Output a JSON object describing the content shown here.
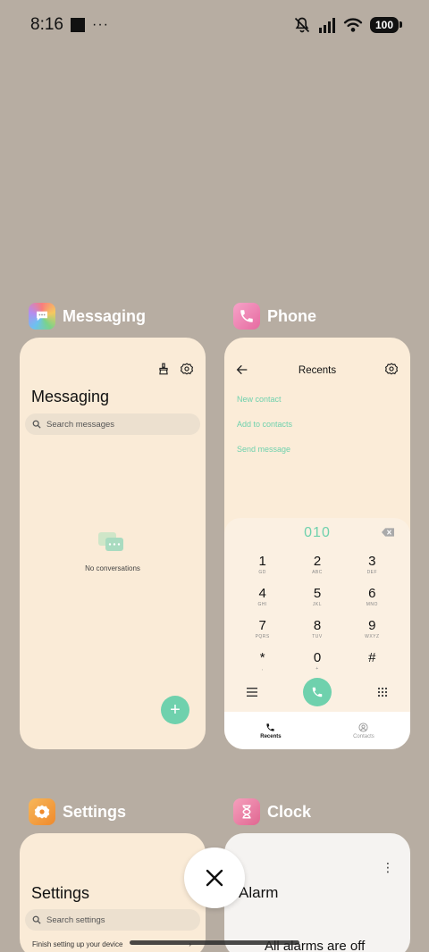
{
  "status_bar": {
    "time": "8:16",
    "dots": "···",
    "battery": "100"
  },
  "colors": {
    "accent": "#6fd1ad",
    "background": "#b7ada2",
    "card": "#faebd7"
  },
  "apps": {
    "messaging": {
      "label": "Messaging",
      "icon": "messaging-icon",
      "title": "Messaging",
      "search_placeholder": "Search messages",
      "empty_text": "No conversations"
    },
    "phone": {
      "label": "Phone",
      "icon": "phone-icon",
      "title": "Recents",
      "links": [
        "New contact",
        "Add to contacts",
        "Send message"
      ],
      "dial_number": "010",
      "keys": [
        {
          "digit": "1",
          "letters": "GD"
        },
        {
          "digit": "2",
          "letters": "ABC"
        },
        {
          "digit": "3",
          "letters": "DEF"
        },
        {
          "digit": "4",
          "letters": "GHI"
        },
        {
          "digit": "5",
          "letters": "JKL"
        },
        {
          "digit": "6",
          "letters": "MNO"
        },
        {
          "digit": "7",
          "letters": "PQRS"
        },
        {
          "digit": "8",
          "letters": "TUV"
        },
        {
          "digit": "9",
          "letters": "WXYZ"
        },
        {
          "digit": "*",
          "letters": ","
        },
        {
          "digit": "0",
          "letters": "+"
        },
        {
          "digit": "#",
          "letters": ""
        }
      ],
      "tabs": {
        "recents": "Recents",
        "contacts": "Contacts"
      }
    },
    "settings": {
      "label": "Settings",
      "icon": "settings-icon",
      "title": "Settings",
      "search_placeholder": "Search settings",
      "row": "Finish setting up your device"
    },
    "clock": {
      "label": "Clock",
      "icon": "clock-icon",
      "title": "Alarm",
      "subtitle": "All alarms are off"
    }
  }
}
